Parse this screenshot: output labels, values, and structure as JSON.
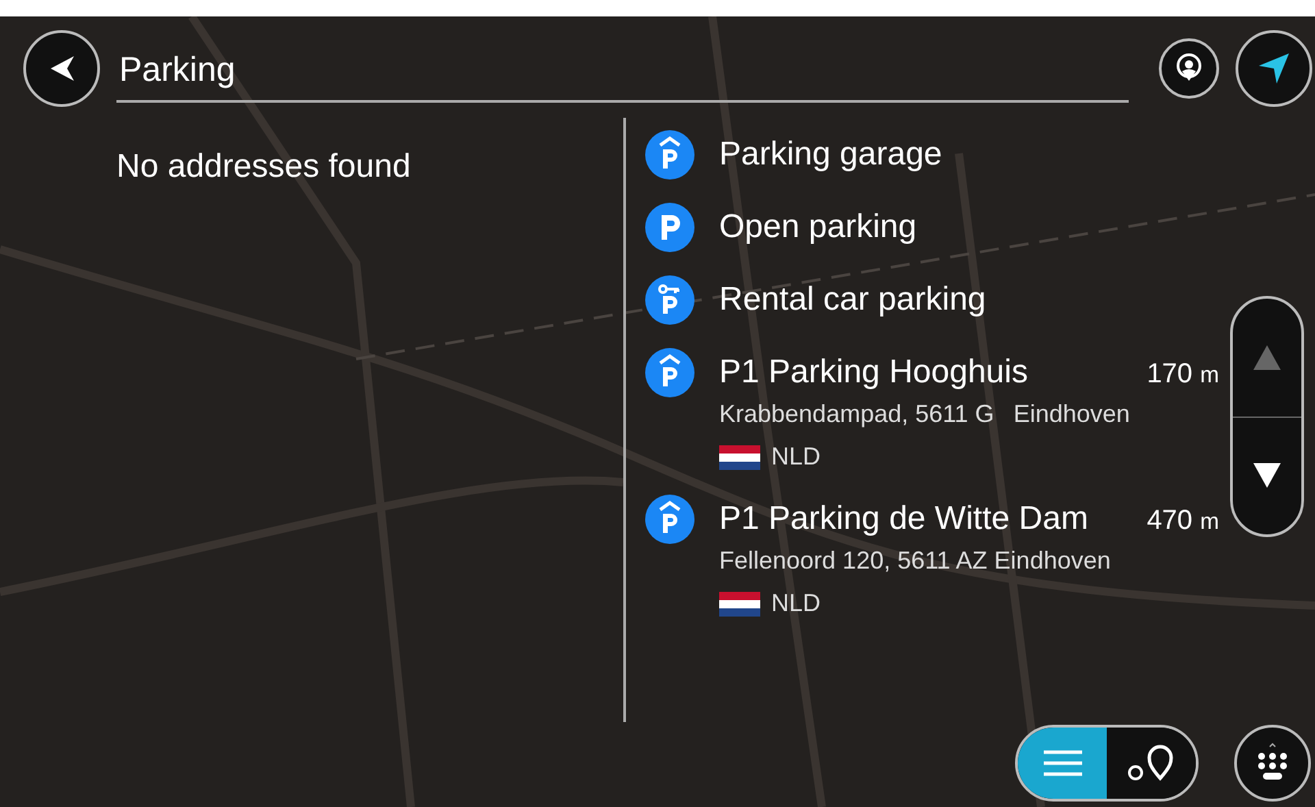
{
  "search": {
    "value": "Parking"
  },
  "addresses": {
    "message": "No addresses found"
  },
  "results": [
    {
      "kind": "garage",
      "name": "Parking garage"
    },
    {
      "kind": "open",
      "name": "Open parking"
    },
    {
      "kind": "rental",
      "name": "Rental car parking"
    },
    {
      "kind": "garage",
      "name": "P1 Parking Hooghuis",
      "distance": "170",
      "unit": "m",
      "address": "Krabbendampad, 5611 G",
      "city": "Eindhoven",
      "country": "NLD"
    },
    {
      "kind": "garage",
      "name": "P1 Parking de Witte Dam",
      "distance": "470",
      "unit": "m",
      "address": "Fellenoord 120, 5611 AZ Eindhoven",
      "country": "NLD"
    }
  ],
  "scroll": {
    "up_disabled": true,
    "down_disabled": false
  },
  "view_toggle": [
    {
      "kind": "list",
      "selected": true
    },
    {
      "kind": "map",
      "selected": false
    }
  ]
}
